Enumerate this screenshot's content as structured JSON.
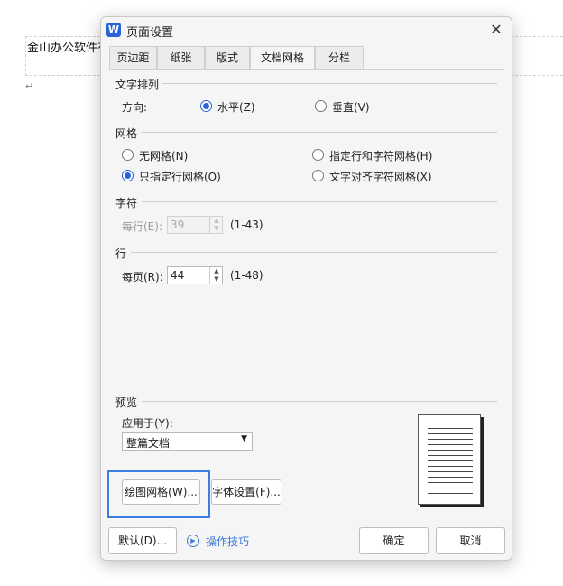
{
  "document": {
    "text": "金山办公软件有",
    "para_mark": "↵"
  },
  "dialog": {
    "title": "页面设置",
    "app_icon": "W",
    "close_glyph": "✕",
    "tabs": [
      {
        "label": "页边距"
      },
      {
        "label": "纸张"
      },
      {
        "label": "版式"
      },
      {
        "label": "文档网格"
      },
      {
        "label": "分栏"
      }
    ],
    "active_tab": "文档网格",
    "text_direction": {
      "section": "文字排列",
      "direction_label": "方向:",
      "horizontal": "水平(Z)",
      "vertical": "垂直(V)",
      "selected": "horizontal"
    },
    "grid": {
      "section": "网格",
      "no_grid": "无网格(N)",
      "line_only": "只指定行网格(O)",
      "line_and_char": "指定行和字符网格(H)",
      "snap_to_char": "文字对齐字符网格(X)",
      "selected": "line_only"
    },
    "characters": {
      "section": "字符",
      "per_line_label": "每行(E):",
      "per_line_value": "39",
      "range": "(1-43)"
    },
    "lines": {
      "section": "行",
      "per_page_label": "每页(R):",
      "per_page_value": "44",
      "range": "(1-48)"
    },
    "preview": {
      "section": "预览",
      "apply_to_label": "应用于(Y):",
      "apply_to_value": "整篇文档"
    },
    "buttons": {
      "draw_grid": "绘图网格(W)...",
      "font_settings": "字体设置(F)...",
      "default": "默认(D)...",
      "tips": "操作技巧",
      "ok": "确定",
      "cancel": "取消"
    },
    "colors": {
      "accent": "#2b63d9",
      "highlight": "#3b7de0",
      "link": "#3a78d8"
    }
  }
}
